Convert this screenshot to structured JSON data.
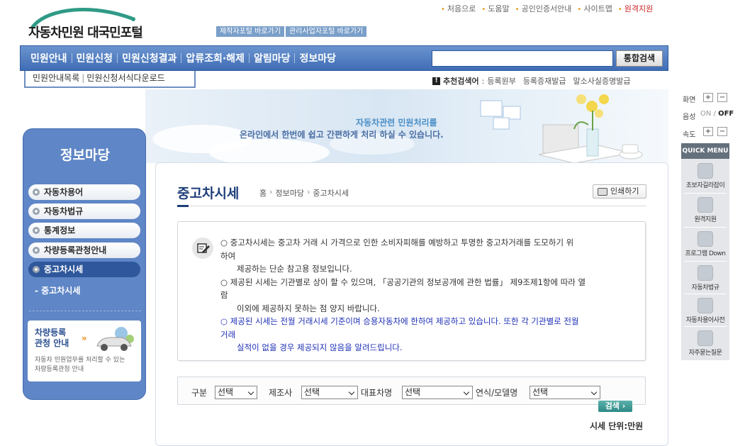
{
  "top_links": [
    "처음으로",
    "도움말",
    "공인인증서안내",
    "사이트맵",
    "원격지원"
  ],
  "logo_text": "자동차민원 대국민포털",
  "portal_buttons": [
    "제작자포털 바로가기",
    "관리사업자포털 바로가기"
  ],
  "gnb": {
    "menu": [
      "민원안내",
      "민원신청",
      "민원신청결과",
      "압류조회·해제",
      "알림마당",
      "정보마당"
    ],
    "search_placeholder": "",
    "search_button": "통합검색"
  },
  "sub_tab": {
    "item1": "민원안내목록",
    "item2": "민원신청서식다운로드"
  },
  "recommend": {
    "label": "추천검색어",
    "keywords": [
      "등록원부",
      "등록증재발급",
      "말소사실증명발급"
    ]
  },
  "banner": {
    "line1": "자동차관련 민원처리를",
    "line2": "온라인에서 한번에 쉽고 간편하게 처리 하실 수 있습니다."
  },
  "sidebar": {
    "title": "정보마당",
    "items": [
      "자동차용어",
      "자동차법규",
      "통계정보",
      "차량등록관청안내",
      "중고차시세"
    ],
    "sub_item": "- 중고차시세",
    "card_title_1": "차량등록",
    "card_title_2": "관청 안내",
    "card_desc_1": "자동차 민원업무를 처리할 수 있는",
    "card_desc_2": "차량등록관청 안내"
  },
  "page": {
    "title": "중고차시세",
    "breadcrumb": [
      "홈",
      "정보마당",
      "중고차시세"
    ],
    "print": "인쇄하기"
  },
  "notice": {
    "l1": "○ 중고차시세는 중고차 거래 시 가격으로 인한 소비자피해를 예방하고 투명한 중고차거래를 도모하기 위",
    "l2": "하여",
    "l3": "제공하는 단순 참고용 정보입니다.",
    "l4": "○ 제공된 시세는 기관별로 상이 할 수 있으며, 「공공기관의 정보공개에 관한 법률」 제9조제1항에 따라 열",
    "l5": "람",
    "l6": "이외에 제공하지 못하는 점 양지 바랍니다.",
    "l7": "○ 제공된 시세는 전월 거래시세 기준이며 승용자동차에 한하여 제공하고 있습니다. 또한 각 기관별로 전월",
    "l8": "거래",
    "l9": "실적이 없을 경우 제공되지 않음을 알려드립니다."
  },
  "filter": {
    "labels": [
      "구분",
      "제조사",
      "대표차명",
      "연식/모델명"
    ],
    "selected": [
      "선택",
      "선택",
      "선택",
      "선택"
    ],
    "search": "검색 ›"
  },
  "unit": "시세 단위:만원",
  "util": {
    "zoom": "화면",
    "voice": "음성",
    "voice_on": "ON",
    "voice_off": "OFF",
    "speed": "속도",
    "plus": "+",
    "minus": "−"
  },
  "quick_menu": {
    "title": "QUICK MENU",
    "items": [
      "초보자길라잡이",
      "원격지원",
      "프로그램 Down",
      "자동차법규",
      "자동차용어사전",
      "자주묻는질문"
    ]
  }
}
